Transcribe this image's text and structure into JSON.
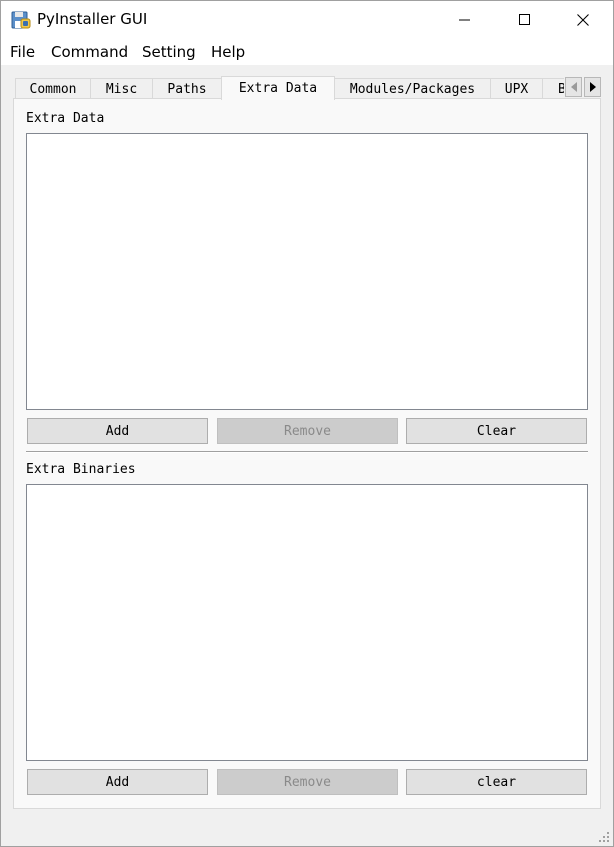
{
  "window": {
    "title": "PyInstaller GUI"
  },
  "icons": {
    "app": "floppy-disk-python-icon",
    "minimize": "minimize-icon",
    "maximize": "maximize-icon",
    "close": "close-icon",
    "tab_scroll_left": "triangle-left-icon",
    "tab_scroll_right": "triangle-right-icon",
    "grip": "resize-grip-icon"
  },
  "menu": {
    "file": "File",
    "command": "Command",
    "setting": "Setting",
    "help": "Help"
  },
  "tabs": {
    "common": "Common",
    "misc": "Misc",
    "paths": "Paths",
    "extra_data": "Extra Data",
    "modules": "Modules/Packages",
    "upx": "UPX",
    "partial": "B"
  },
  "active_tab": "Extra Data",
  "extra_data": {
    "label": "Extra Data",
    "add": "Add",
    "remove": "Remove",
    "clear": "Clear"
  },
  "extra_binaries": {
    "label": "Extra Binaries",
    "add": "Add",
    "remove": "Remove",
    "clear": "clear"
  },
  "colors": {
    "accent_disabled": "#cccccc",
    "list_border": "#828790"
  }
}
